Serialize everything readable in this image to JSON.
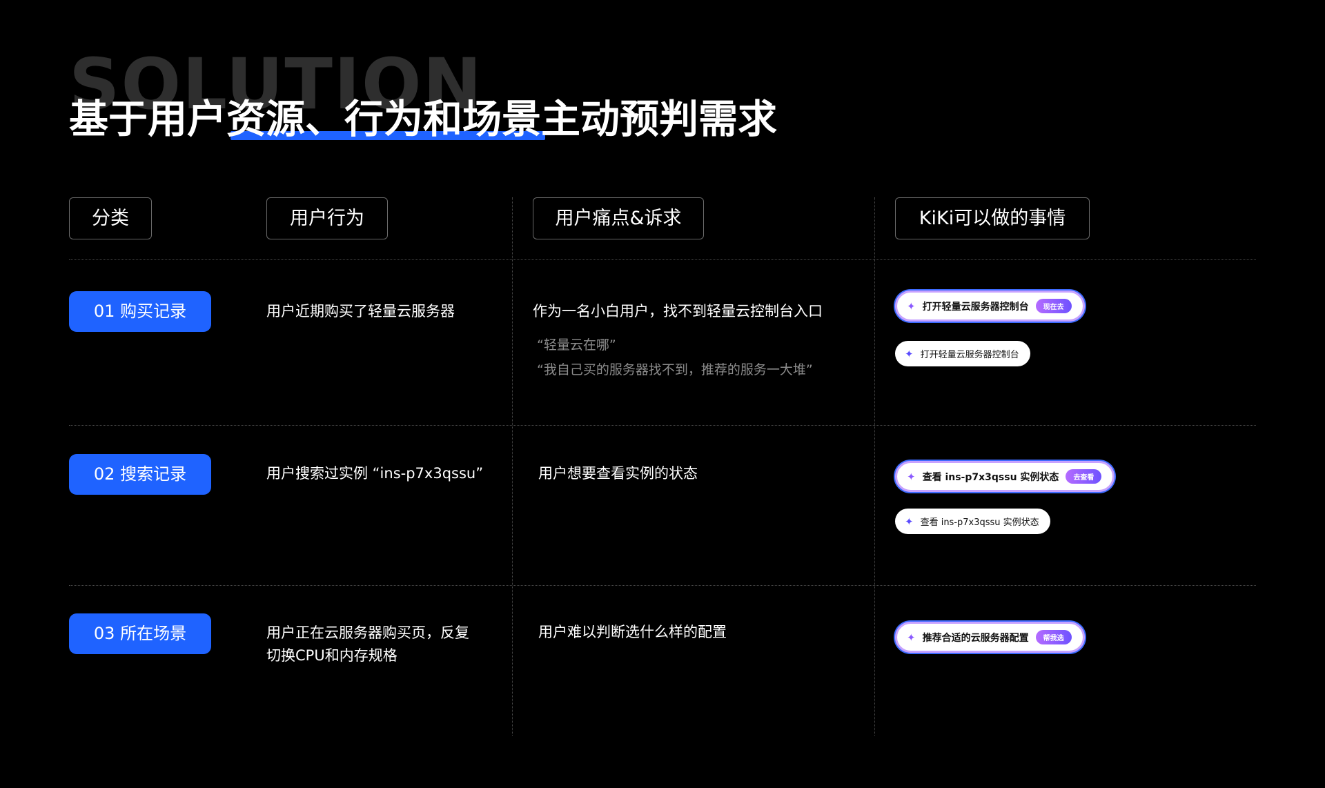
{
  "bg_word": "SOLUTION",
  "title": "基于用户资源、行为和场景主动预判需求",
  "headers": {
    "category": "分类",
    "behavior": "用户行为",
    "pain": "用户痛点&诉求",
    "kiki": "KiKi可以做的事情"
  },
  "rows": [
    {
      "category": "01 购买记录",
      "behavior": "用户近期购买了轻量云服务器",
      "pain": "作为一名小白用户，找不到轻量云控制台入口",
      "quotes": [
        "“轻量云在哪”",
        "“我自己买的服务器找不到，推荐的服务一大堆”"
      ],
      "actions": [
        {
          "text": "打开轻量云服务器控制台",
          "badge": "现在去",
          "icon": "sparkle-icon"
        },
        {
          "text": "打开轻量云服务器控制台",
          "icon": "sparkle-icon"
        }
      ]
    },
    {
      "category": "02 搜索记录",
      "behavior": "用户搜索过实例 “ins-p7x3qssu”",
      "pain": "用户想要查看实例的状态",
      "actions": [
        {
          "text": "查看 ins-p7x3qssu 实例状态",
          "badge": "去查看",
          "icon": "sparkle-icon"
        },
        {
          "text": "查看 ins-p7x3qssu 实例状态",
          "icon": "sparkle-icon"
        }
      ]
    },
    {
      "category": "03 所在场景",
      "behavior_lines": [
        "用户正在云服务器购买页，反复",
        "切换CPU和内存规格"
      ],
      "pain": "用户难以判断选什么样的配置",
      "actions": [
        {
          "text": "推荐合适的云服务器配置",
          "badge": "帮我选",
          "icon": "sparkle-icon"
        }
      ]
    }
  ],
  "colors": {
    "background": "#000000",
    "accent_blue": "#1f63ff",
    "badge_gradient_start": "#b46bff",
    "badge_gradient_end": "#6e52ff",
    "pill_border": "#c7a2ff"
  }
}
